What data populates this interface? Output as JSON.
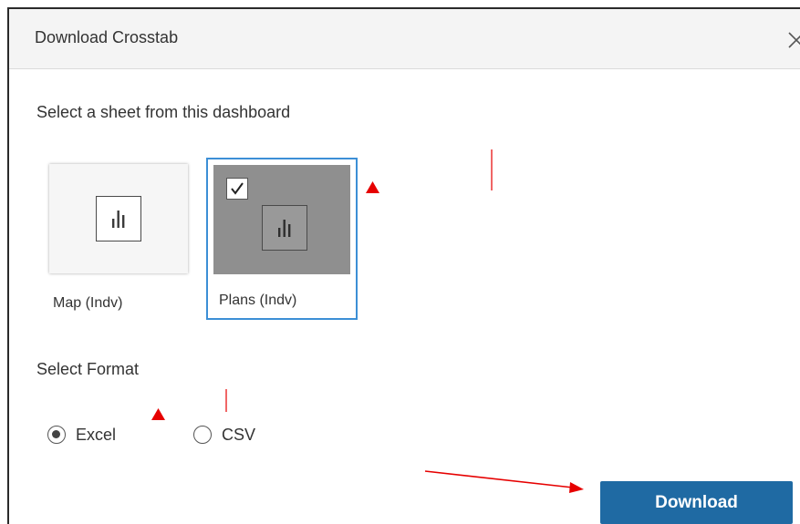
{
  "dialog": {
    "title": "Download Crosstab",
    "close_icon": "close-icon"
  },
  "sheet_section": {
    "label": "Select a sheet from this dashboard",
    "sheets": [
      {
        "name": "Map (Indv)",
        "selected": false,
        "icon": "bar-chart-icon"
      },
      {
        "name": "Plans (Indv)",
        "selected": true,
        "icon": "bar-chart-icon"
      }
    ]
  },
  "format_section": {
    "label": "Select Format",
    "options": [
      {
        "label": "Excel",
        "selected": true
      },
      {
        "label": "CSV",
        "selected": false
      }
    ]
  },
  "actions": {
    "download_label": "Download"
  },
  "colors": {
    "primary_button": "#1f6aa3",
    "selected_border": "#3c8fd6",
    "annotation": "#e60000"
  }
}
